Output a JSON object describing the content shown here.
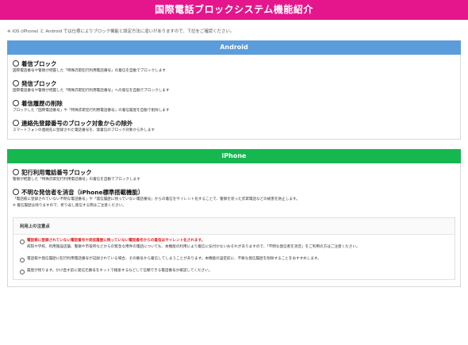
{
  "header": {
    "title": "国際電話ブロックシステム機能紹介"
  },
  "note": "※ iOS (iPhone) と Android では仕様によりブロック機能と設定方法に違いがありますので、下記をご確認ください。",
  "android": {
    "heading": "Android",
    "items": [
      {
        "title": "着信ブロック",
        "desc": "国際電話番号や警察が把握した「特殊詐欺犯行利用電話番号」の着信を自動でブロックします"
      },
      {
        "title": "発信ブロック",
        "desc": "国際電話番号や警察が把握した「特殊詐欺犯行利用電話番号」への発信を自動でブロックします"
      },
      {
        "title": "着信履歴の削除",
        "desc": "ブロックした「国際電話番号」や「特殊詐欺犯行利用電話番号」の着信履歴を自動で削除します"
      },
      {
        "title": "連絡先登録番号のブロック対象からの除外",
        "desc": "スマートフォンの連絡先に登録された電話番号を、発着信のブロック対象から外します"
      }
    ]
  },
  "iphone": {
    "heading": "iPhone",
    "items": [
      {
        "title": "犯行利用電話番号ブロック",
        "desc": "警察が把握した「特殊詐欺犯行利用電話番号」の着信を自動でブロックします"
      },
      {
        "title": "不明な発信者を消音（iPhone標準搭載機能）",
        "desc": "「電話帳に登録されていない不明な電話番号」や「発信履歴に残っていない電話番号」からの着信をサイレント化することで、警察を装った詐欺電話などの被害を防止します。",
        "desc2": "※ 着信履歴は残りますので、折り返し発信する際はご注意ください。"
      }
    ],
    "caution": {
      "title": "利用上の注意点",
      "items": [
        {
          "red": "電話帳に登録されていない電話番号や発信履歴に残っていない電話番号からの着信はサイレント化されます。",
          "text": "病院や学校、利用施設店舗、警察や市役所などからの緊急な用件の電話についても、本機能の利用により着信に気付かないおそれがありますので、「不明な発信者を消音」をご利用の方はご注意ください。"
        },
        {
          "red": "",
          "text": "電話帳や発信履歴に犯行利用電話番号が記録されている場合、その番号から着信してしまうことがあります。本機能の設定前に、不要な発信履歴を削除することをおすすめします。"
        },
        {
          "red": "",
          "text": "履歴が残ります。かけ直す前に発信元番号をネットで検索するなどして信頼できる電話番号か確認してください。"
        }
      ]
    }
  },
  "colors": {
    "header": "#e5168c",
    "android": "#5b9ddb",
    "iphone": "#17b750",
    "alert": "#e02020"
  }
}
